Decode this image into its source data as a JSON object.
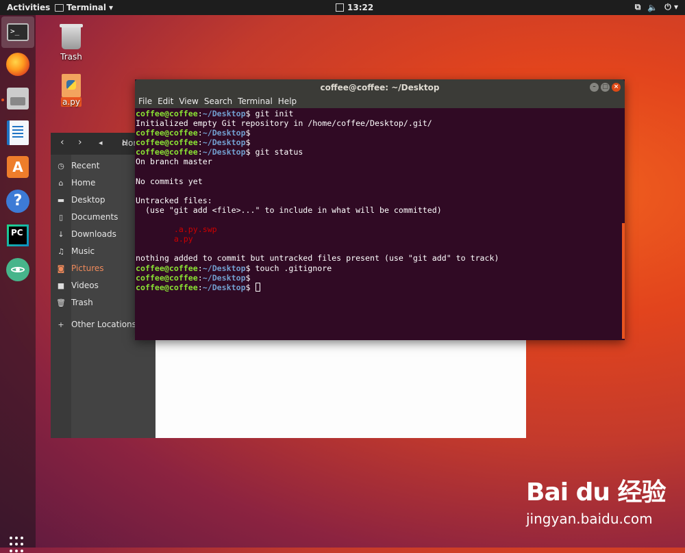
{
  "topbar": {
    "activities": "Activities",
    "app_name": "Terminal",
    "clock": "13:22",
    "tray_icons": [
      "network-icon",
      "volume-icon",
      "power-icon"
    ]
  },
  "dock": {
    "items": [
      "terminal",
      "firefox",
      "files",
      "libreoffice-writer",
      "software-center",
      "help",
      "pycharm",
      "atom"
    ],
    "accent": "#e95420"
  },
  "desktop": {
    "icons": [
      {
        "label": "Trash",
        "icon": "trash-icon"
      },
      {
        "label": "a.py",
        "icon": "python-file-icon"
      }
    ]
  },
  "files": {
    "path_fragment": "Hor",
    "places": [
      {
        "label": "Recent",
        "icon": "clock-icon"
      },
      {
        "label": "Home",
        "icon": "home-icon"
      },
      {
        "label": "Desktop",
        "icon": "folder-icon"
      },
      {
        "label": "Documents",
        "icon": "document-icon"
      },
      {
        "label": "Downloads",
        "icon": "download-icon"
      },
      {
        "label": "Music",
        "icon": "music-icon"
      },
      {
        "label": "Pictures",
        "icon": "camera-icon"
      },
      {
        "label": "Videos",
        "icon": "video-icon"
      },
      {
        "label": "Trash",
        "icon": "trash-icon"
      },
      {
        "label": "Other Locations",
        "icon": "plus-icon"
      }
    ],
    "selected": "Pictures"
  },
  "terminal": {
    "title": "coffee@coffee: ~/Desktop",
    "menu": [
      "File",
      "Edit",
      "View",
      "Search",
      "Terminal",
      "Help"
    ],
    "user": "coffee@coffee",
    "path": "~/Desktop",
    "lines": [
      {
        "type": "prompt",
        "cmd": " git init"
      },
      {
        "type": "out",
        "text": "Initialized empty Git repository in /home/coffee/Desktop/.git/"
      },
      {
        "type": "prompt",
        "cmd": ""
      },
      {
        "type": "prompt",
        "cmd": ""
      },
      {
        "type": "prompt",
        "cmd": " git status"
      },
      {
        "type": "out",
        "text": "On branch master"
      },
      {
        "type": "out",
        "text": ""
      },
      {
        "type": "out",
        "text": "No commits yet"
      },
      {
        "type": "out",
        "text": ""
      },
      {
        "type": "out",
        "text": "Untracked files:"
      },
      {
        "type": "out",
        "text": "  (use \"git add <file>...\" to include in what will be committed)"
      },
      {
        "type": "out",
        "text": ""
      },
      {
        "type": "red",
        "text": "\t.a.py.swp"
      },
      {
        "type": "red",
        "text": "\ta.py"
      },
      {
        "type": "out",
        "text": ""
      },
      {
        "type": "out",
        "text": "nothing added to commit but untracked files present (use \"git add\" to track)"
      },
      {
        "type": "prompt",
        "cmd": " touch .gitignore"
      },
      {
        "type": "prompt",
        "cmd": ""
      },
      {
        "type": "prompt",
        "cmd": " ",
        "cursor": true
      }
    ]
  },
  "watermark": {
    "logo": "Bai du 经验",
    "url": "jingyan.baidu.com"
  }
}
